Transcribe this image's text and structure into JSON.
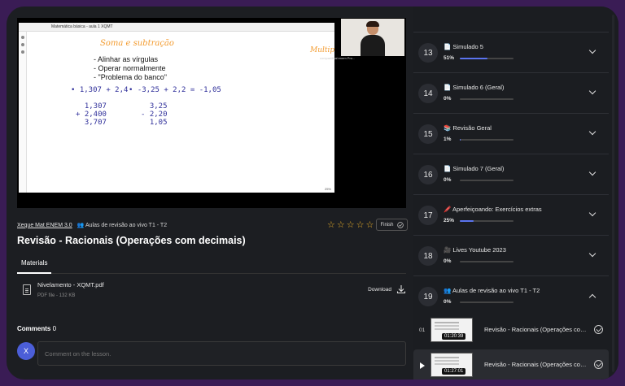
{
  "video": {
    "browser_tab": "Matemática básica - aula 1 XQMT",
    "zoom": "25%",
    "slide": {
      "title": "Soma e subtração",
      "bullets": [
        "- Alinhar as vírgulas",
        "- Operar normalmente",
        "- \"Problema do banco\""
      ],
      "expr1": "• 1,307 + 2,4",
      "expr2": "• -3,25 + 2,2 = -1,05",
      "calc1": "  1,307\n+ 2,400\n  3,707",
      "calc2": "  3,25\n- 2,20\n  1,05",
      "side_note": "Multip"
    },
    "cam_caption": "compartilhal enem Pro..."
  },
  "breadcrumb": {
    "course": "Xeque Mat ENEM 3.0",
    "module": "👥 Aulas de revisão ao vivo T1 - T2"
  },
  "rating": {
    "stars": [
      "☆",
      "☆",
      "☆",
      "☆",
      "☆"
    ]
  },
  "finish_label": "Finish",
  "lesson_title": "Revisão - Racionais (Operações com decimais)",
  "tabs": {
    "materials": "Materials"
  },
  "material": {
    "name": "Nivelamento - XQMT.pdf",
    "meta": "PDF file - 132 KB",
    "download_label": "Download"
  },
  "comments": {
    "label": "Comments",
    "count": "0",
    "avatar_letter": "X",
    "placeholder": "Comment on the lesson."
  },
  "modules": [
    {
      "num": "13",
      "title": "📄 Simulado 5",
      "pct": "51%",
      "progress": 0.51
    },
    {
      "num": "14",
      "title": "📄 Simulado 6 (Geral)",
      "pct": "0%",
      "progress": 0
    },
    {
      "num": "15",
      "title": "📚 Revisão Geral",
      "pct": "1%",
      "progress": 0.01
    },
    {
      "num": "16",
      "title": "📄 Simulado 7 (Geral)",
      "pct": "0%",
      "progress": 0
    },
    {
      "num": "17",
      "title": "🖍️ Aperfeiçoando: Exercícios extras",
      "pct": "25%",
      "progress": 0.25
    },
    {
      "num": "18",
      "title": "🎥 Lives Youtube 2023",
      "pct": "0%",
      "progress": 0
    },
    {
      "num": "19",
      "title": "👥 Aulas de revisão ao vivo T1 - T2",
      "pct": "0%",
      "progress": 0
    }
  ],
  "lessons": [
    {
      "idx": "01",
      "duration": "01:20:39",
      "title": "Revisão - Racionais (Operações com decimais)"
    },
    {
      "idx": "",
      "duration": "01:27:01",
      "title": "Revisão - Racionais (Operações com decimais)"
    }
  ],
  "colors": {
    "accent": "#5b74ef",
    "frame": "#3a1c55",
    "star": "#f0b429",
    "slide_title": "#f39b2f"
  }
}
